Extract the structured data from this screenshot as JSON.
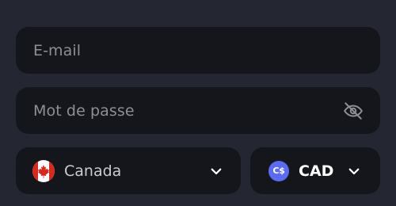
{
  "form": {
    "email_placeholder": "E-mail",
    "password_placeholder": "Mot de passe",
    "password_toggle_icon": "eye-off-icon"
  },
  "country": {
    "label": "Canada",
    "flag_icon": "canada-flag-icon"
  },
  "currency": {
    "badge": "C$",
    "label": "CAD",
    "badge_color": "#5b6cf0"
  },
  "colors": {
    "background": "#242731",
    "field": "#15161c",
    "placeholder": "#8d8f97",
    "text": "#ffffff"
  }
}
